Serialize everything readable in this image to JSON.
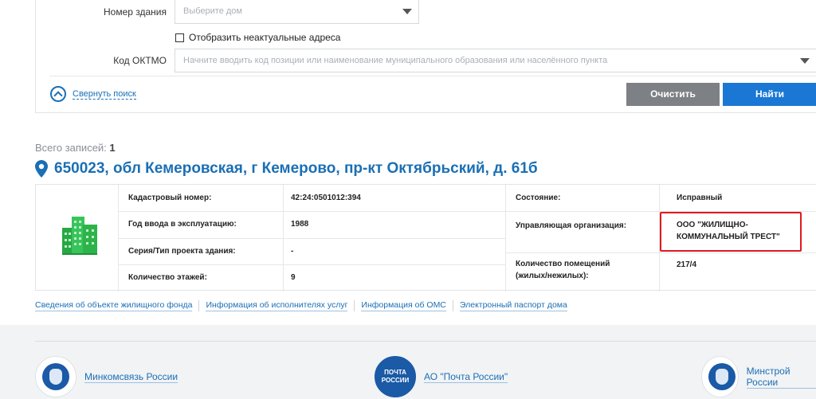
{
  "search": {
    "building_label": "Номер здания",
    "building_placeholder": "Выберите дом",
    "checkbox_label": "Отобразить неактуальные адреса",
    "checkbox_checked": false,
    "oktmo_label": "Код ОКТМО",
    "oktmo_placeholder": "Начните вводить код позиции или наименование муниципального образования или населённого пункта",
    "collapse_label": "Свернуть поиск",
    "clear_label": "Очистить",
    "find_label": "Найти"
  },
  "results": {
    "total_label": "Всего записей:",
    "total_count": "1",
    "address": "650023, обл Кемеровская, г Кемерово, пр-кт Октябрьский, д. 61б",
    "fields": {
      "cadastral_label": "Кадастровый номер:",
      "cadastral_value": "42:24:0501012:394",
      "year_label": "Год ввода в эксплуатацию:",
      "year_value": "1988",
      "series_label": "Серия/Тип проекта здания:",
      "series_value": "-",
      "floors_label": "Количество этажей:",
      "floors_value": "9",
      "state_label": "Состояние:",
      "state_value": "Исправный",
      "org_label": "Управляющая организация:",
      "org_value_line1": "ООО \"ЖИЛИЩНО-",
      "org_value_line2": "КОММУНАЛЬНЫЙ ТРЕСТ\"",
      "rooms_label_line1": "Количество помещений",
      "rooms_label_line2": "(жилых/нежилых):",
      "rooms_value": "217/4"
    },
    "links": [
      "Сведения об объекте жилищного фонда",
      "Информация об исполнителях услуг",
      "Информация об ОМС",
      "Электронный паспорт дома"
    ]
  },
  "footer": {
    "partners": [
      "Минкомсвязь России",
      "АО \"Почта России\"",
      "Минстрой России"
    ],
    "post_logo_line1": "ПОЧТА",
    "post_logo_line2": "РОССИИ"
  },
  "colors": {
    "link": "#1a6fb5",
    "primary_button": "#1a78d4",
    "secondary_button": "#7d8085",
    "highlight": "#e0191f",
    "building_icon": "#2db34a"
  }
}
